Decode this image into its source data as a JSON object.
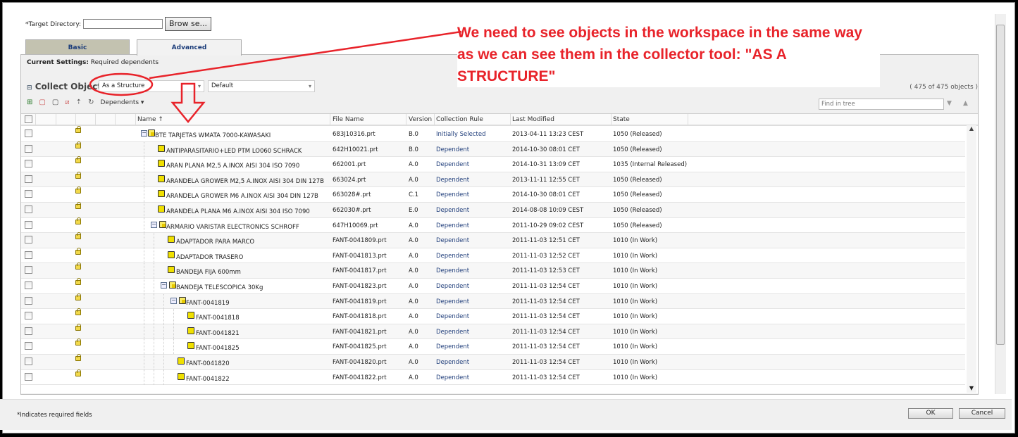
{
  "form": {
    "target_dir_label": "*Target Directory:",
    "target_dir_value": "",
    "browse_label": "Brow se..."
  },
  "tabs": [
    {
      "label": "Basic",
      "active": false
    },
    {
      "label": "Advanced",
      "active": true
    }
  ],
  "settings": {
    "label": "Current Settings:",
    "value": "Required dependents"
  },
  "collect": {
    "label": "Collect Objects",
    "mode": "As a Structure",
    "view": "Default",
    "count": "( 475 of 475 objects )"
  },
  "toolbar": {
    "dependents_label": "Dependents",
    "icons": [
      "add-object-icon",
      "remove-icon",
      "clear-icon",
      "exclude-icon",
      "refresh-icon",
      "sync-icon"
    ]
  },
  "find": {
    "placeholder": "Find in tree"
  },
  "columns": [
    "Name",
    "File Name",
    "Version",
    "Collection Rule",
    "Last Modified",
    "State"
  ],
  "sort": {
    "column": "Name",
    "direction": "ascending"
  },
  "rows": [
    {
      "name": "BTE TARJETAS WMATA 7000-KAWASAKI",
      "level": 0,
      "assembly": true,
      "file": "683J10316.prt",
      "version": "B.0",
      "rule": "Initially Selected",
      "modified": "2013-04-11 13:23 CEST",
      "state": "1050 (Released)"
    },
    {
      "name": "ANTIPARASITARIO+LED  PTM LO060 SCHRACK",
      "level": 1,
      "assembly": false,
      "file": "642H10021.prt",
      "version": "B.0",
      "rule": "Dependent",
      "modified": "2014-10-30 08:01 CET",
      "state": "1050 (Released)"
    },
    {
      "name": "ARAN PLANA M2,5  A.INOX AISI 304  ISO 7090",
      "level": 1,
      "assembly": false,
      "file": "662001.prt",
      "version": "A.0",
      "rule": "Dependent",
      "modified": "2014-10-31 13:09 CET",
      "state": "1035 (Internal Released)"
    },
    {
      "name": "ARANDELA GROWER M2,5  A.INOX AISI 304  DIN 127B",
      "level": 1,
      "assembly": false,
      "file": "663024.prt",
      "version": "A.0",
      "rule": "Dependent",
      "modified": "2013-11-11 12:55 CET",
      "state": "1050 (Released)"
    },
    {
      "name": "ARANDELA GROWER M6  A.INOX AISI 304  DIN 127B",
      "level": 1,
      "assembly": false,
      "file": "663028#.prt",
      "version": "C.1",
      "rule": "Dependent",
      "modified": "2014-10-30 08:01 CET",
      "state": "1050 (Released)"
    },
    {
      "name": "ARANDELA PLANA M6  A.INOX AISI 304  ISO 7090",
      "level": 1,
      "assembly": false,
      "file": "662030#.prt",
      "version": "E.0",
      "rule": "Dependent",
      "modified": "2014-08-08 10:09 CEST",
      "state": "1050 (Released)"
    },
    {
      "name": "ARMARIO VARISTAR ELECTRONICS SCHROFF",
      "level": 1,
      "assembly": true,
      "file": "647H10069.prt",
      "version": "A.0",
      "rule": "Dependent",
      "modified": "2011-10-29 09:02 CEST",
      "state": "1050 (Released)"
    },
    {
      "name": "ADAPTADOR PARA MARCO",
      "level": 2,
      "assembly": false,
      "file": "FANT-0041809.prt",
      "version": "A.0",
      "rule": "Dependent",
      "modified": "2011-11-03 12:51 CET",
      "state": "1010 (In Work)"
    },
    {
      "name": "ADAPTADOR TRASERO",
      "level": 2,
      "assembly": false,
      "file": "FANT-0041813.prt",
      "version": "A.0",
      "rule": "Dependent",
      "modified": "2011-11-03 12:52 CET",
      "state": "1010 (In Work)"
    },
    {
      "name": "BANDEJA FIJA 600mm",
      "level": 2,
      "assembly": false,
      "file": "FANT-0041817.prt",
      "version": "A.0",
      "rule": "Dependent",
      "modified": "2011-11-03 12:53 CET",
      "state": "1010 (In Work)"
    },
    {
      "name": "BANDEJA TELESCOPICA 30Kg",
      "level": 2,
      "assembly": true,
      "file": "FANT-0041823.prt",
      "version": "A.0",
      "rule": "Dependent",
      "modified": "2011-11-03 12:54 CET",
      "state": "1010 (In Work)"
    },
    {
      "name": "FANT-0041819",
      "level": 3,
      "assembly": true,
      "file": "FANT-0041819.prt",
      "version": "A.0",
      "rule": "Dependent",
      "modified": "2011-11-03 12:54 CET",
      "state": "1010 (In Work)"
    },
    {
      "name": "FANT-0041818",
      "level": 4,
      "assembly": false,
      "file": "FANT-0041818.prt",
      "version": "A.0",
      "rule": "Dependent",
      "modified": "2011-11-03 12:54 CET",
      "state": "1010 (In Work)"
    },
    {
      "name": "FANT-0041821",
      "level": 4,
      "assembly": false,
      "file": "FANT-0041821.prt",
      "version": "A.0",
      "rule": "Dependent",
      "modified": "2011-11-03 12:54 CET",
      "state": "1010 (In Work)"
    },
    {
      "name": "FANT-0041825",
      "level": 4,
      "assembly": false,
      "file": "FANT-0041825.prt",
      "version": "A.0",
      "rule": "Dependent",
      "modified": "2011-11-03 12:54 CET",
      "state": "1010 (In Work)"
    },
    {
      "name": "FANT-0041820",
      "level": 3,
      "assembly": false,
      "file": "FANT-0041820.prt",
      "version": "A.0",
      "rule": "Dependent",
      "modified": "2011-11-03 12:54 CET",
      "state": "1010 (In Work)"
    },
    {
      "name": "FANT-0041822",
      "level": 3,
      "assembly": false,
      "file": "FANT-0041822.prt",
      "version": "A.0",
      "rule": "Dependent",
      "modified": "2011-11-03 12:54 CET",
      "state": "1010 (In Work)"
    }
  ],
  "footer": {
    "required_note": "*Indicates required fields",
    "ok_label": "OK",
    "cancel_label": "Cancel"
  },
  "annotation": {
    "text": "We need to see objects in the workspace in the same way as we can see them in the collector tool: \"AS A STRUCTURE\"",
    "color": "#e8232a"
  }
}
